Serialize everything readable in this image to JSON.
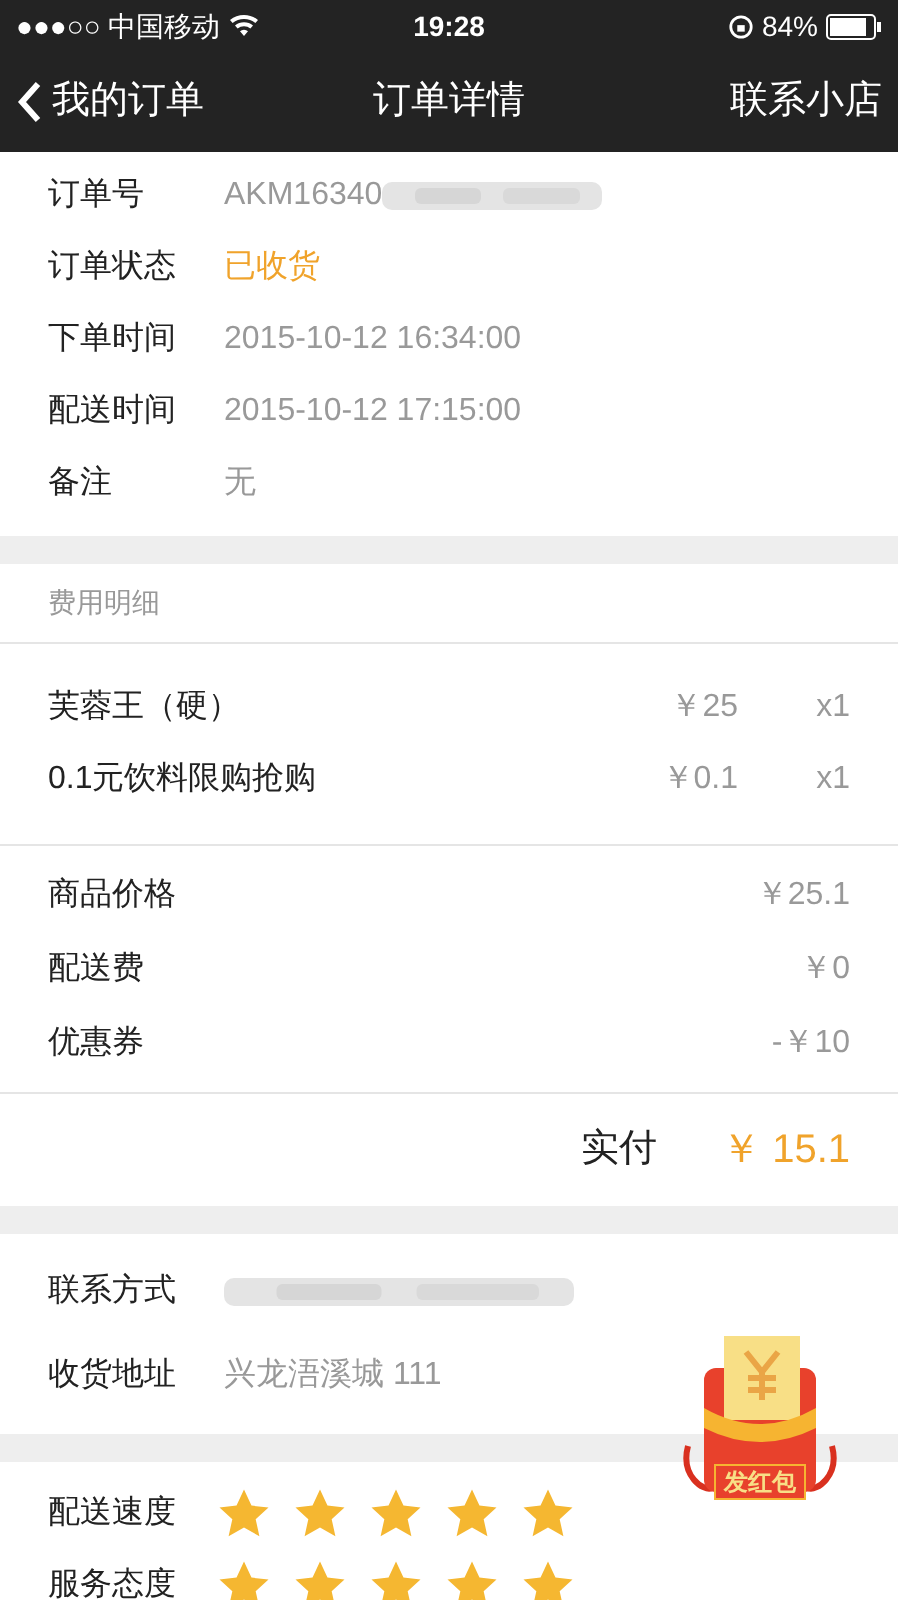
{
  "status_bar": {
    "carrier": "●●●○○ 中国移动",
    "time": "19:28",
    "battery": "84%"
  },
  "nav": {
    "back": "我的订单",
    "title": "订单详情",
    "action": "联系小店"
  },
  "order_info": [
    {
      "label": "订单号",
      "value": "AKM16340",
      "kind": "blurred"
    },
    {
      "label": "订单状态",
      "value": "已收货",
      "kind": "status"
    },
    {
      "label": "下单时间",
      "value": "2015-10-12 16:34:00",
      "kind": "plain"
    },
    {
      "label": "配送时间",
      "value": "2015-10-12 17:15:00",
      "kind": "plain"
    },
    {
      "label": "备注",
      "value": "无",
      "kind": "plain"
    }
  ],
  "fees": {
    "title": "费用明细",
    "items": [
      {
        "name": "芙蓉王（硬）",
        "price": "￥25",
        "qty": "x1"
      },
      {
        "name": "0.1元饮料限购抢购",
        "price": "￥0.1",
        "qty": "x1"
      }
    ],
    "summary": [
      {
        "label": "商品价格",
        "value": "￥25.1"
      },
      {
        "label": "配送费",
        "value": "￥0"
      },
      {
        "label": "优惠券",
        "value": "-￥10"
      }
    ],
    "total": {
      "label": "实付",
      "value": "￥ 15.1"
    }
  },
  "delivery": [
    {
      "label": "联系方式",
      "kind": "blurred"
    },
    {
      "label": "收货地址",
      "value": "兴龙浯溪城 111",
      "kind": "plain"
    }
  ],
  "ratings": [
    {
      "label": "配送速度",
      "stars": 5
    },
    {
      "label": "服务态度",
      "stars": 5
    }
  ],
  "red_packet": {
    "label": "发红包"
  }
}
